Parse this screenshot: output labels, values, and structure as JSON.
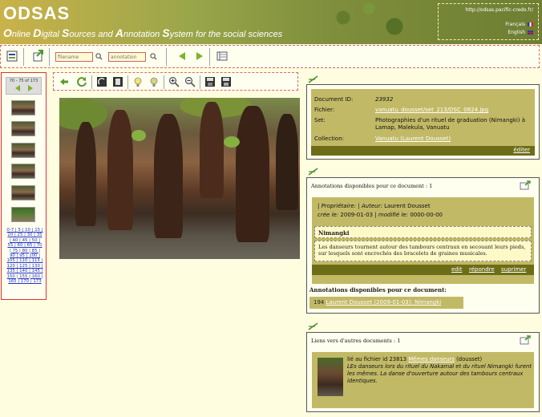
{
  "header": {
    "brand": "ODSAS",
    "tagline_parts": [
      "O",
      "nline ",
      "D",
      "igital ",
      "S",
      "ources and ",
      "A",
      "nnotation ",
      "S",
      "ystem for the social sciences"
    ],
    "url": "http://odsas.pacific-credo.fr/",
    "languages": [
      {
        "label": "Français",
        "flag": "fr-flag-icon"
      },
      {
        "label": "English",
        "flag": "uk-flag-icon"
      }
    ]
  },
  "toolbar": {
    "search_filename_placeholder": "filename",
    "search_annotation_placeholder": "annotation"
  },
  "sidebar": {
    "pager_text": "70 - 75 of 173",
    "page_links": "0-7 | 5 | 10 | 15 | 20 | 25 | 30 | 35 | 40 | 45 | 50 | 55 | 60 | 65 | 70 | 75 | 80 | 85 | 90 | 95 | 100 | 105 | 110 | 115 | 120 | 125 | 130 | 135 | 140 | 145 | 150 | 155 | 160 | 165 | 170 | 173"
  },
  "document": {
    "id_label": "Document ID:",
    "id_value": "23932",
    "file_label": "Fichier:",
    "file_value": "vanuatu_dousset/set_213/DSC_0824.jpg",
    "set_label": "Set:",
    "set_value": "Photographies d'un rituel de graduation (Nimangki) à Lamap, Malekula, Vanuatu",
    "collection_label": "Collection:",
    "collection_value": "Vanuatu (Laurent Dousset)",
    "edit_label": "éditer"
  },
  "annotations": {
    "heading": "Annotations disponibles pour ce document : 1",
    "owner_label": "Propriétaire:",
    "author_label": "Auteur:",
    "author_value": "Laurent Dousset",
    "created_label": "crée le:",
    "created_value": "2009-01-03",
    "modified_label": "modifié le:",
    "modified_value": "0000-00-00",
    "title": "Nimangki",
    "body": "Les danseurs tournent autour des tambours centraux en secouant leurs pieds, sur lesquels sont encrochés des bracelets de graines musicales.",
    "actions": [
      "edit",
      "répondre",
      "suprimer"
    ],
    "sub_heading": "Annotations disponibles pour ce document:",
    "ref_id": "194",
    "ref_link": "Laurent Dousset (2009-01-03): Nimangki"
  },
  "links": {
    "heading": "Liens vers d'autres documents : 1",
    "prefix": "lié au fichier id 23813",
    "link_text": "Mêmes danseurs",
    "suffix": "(dousset)",
    "description": "LEs danseurs lors du rituel du Nakamal et du rituel Nimangki furent les mêmes. La danse d'ouverture autour des tambours centraux identiques."
  },
  "colors": {
    "accent_green": "#7fb12a",
    "panel_olive": "#c2b966",
    "bar_dark": "#6d6d18",
    "page_bg": "#fffde0"
  }
}
